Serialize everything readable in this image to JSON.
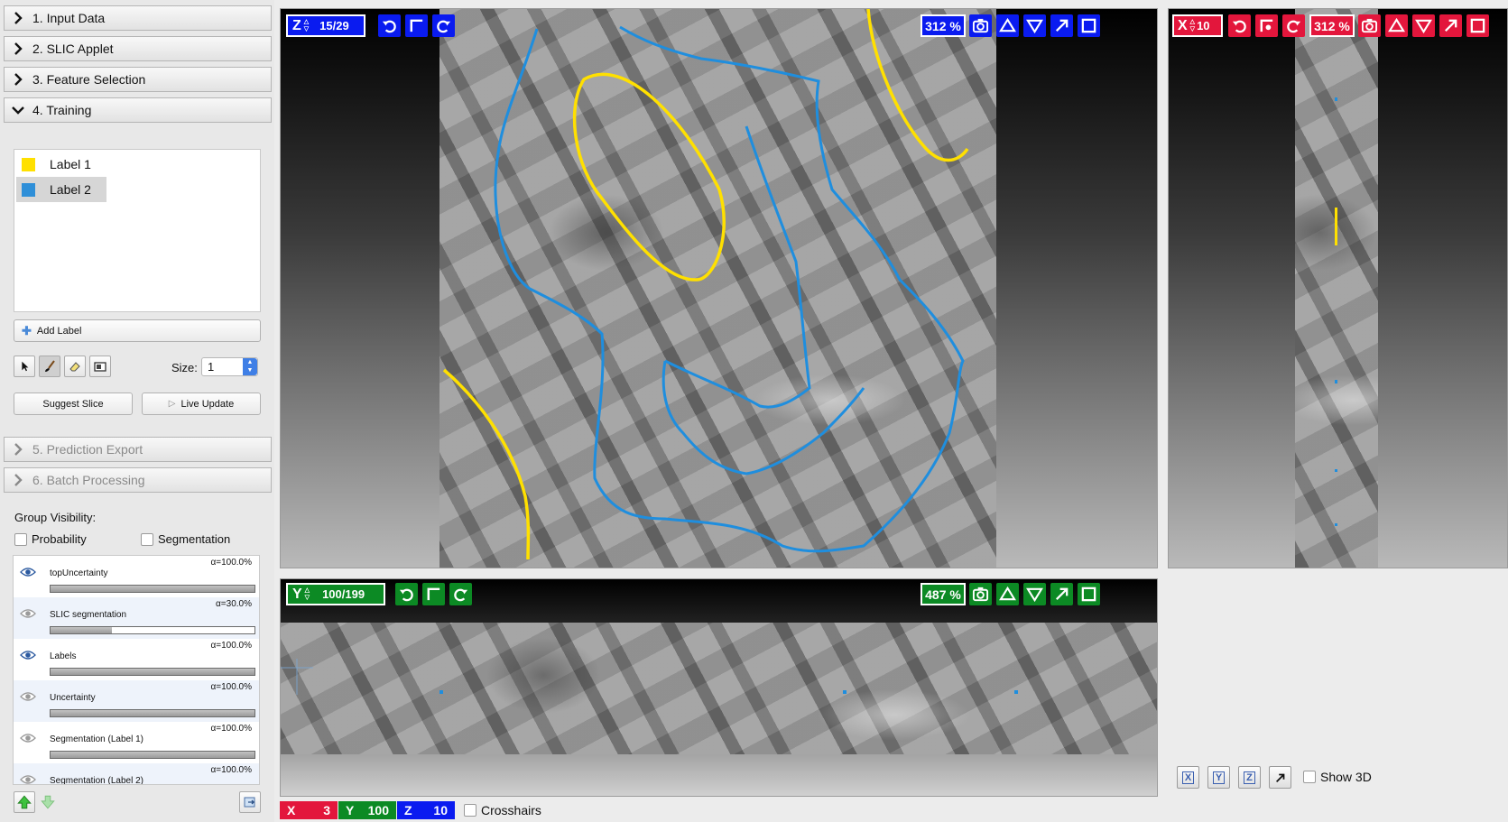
{
  "applets": [
    {
      "label": "1. Input Data",
      "expanded": false,
      "enabled": true
    },
    {
      "label": "2. SLIC Applet",
      "expanded": false,
      "enabled": true
    },
    {
      "label": "3. Feature Selection",
      "expanded": false,
      "enabled": true
    },
    {
      "label": "4. Training",
      "expanded": true,
      "enabled": true
    },
    {
      "label": "5. Prediction Export",
      "expanded": false,
      "enabled": false
    },
    {
      "label": "6. Batch Processing",
      "expanded": false,
      "enabled": false
    }
  ],
  "training": {
    "labels": [
      {
        "name": "Label 1",
        "color": "#ffe000",
        "selected": false
      },
      {
        "name": "Label 2",
        "color": "#2f8fd8",
        "selected": true
      }
    ],
    "add_label": "Add Label",
    "size_label": "Size:",
    "size_value": "1",
    "suggest_slice": "Suggest Slice",
    "live_update": "Live Update"
  },
  "group_visibility": {
    "title": "Group Visibility:",
    "probability": "Probability",
    "segmentation": "Segmentation"
  },
  "layers": [
    {
      "name": "topUncertainty",
      "alpha_text": "α=100.0%",
      "alpha": 1.0,
      "visible": true
    },
    {
      "name": "SLIC segmentation",
      "alpha_text": "α=30.0%",
      "alpha": 0.3,
      "visible": false
    },
    {
      "name": "Labels",
      "alpha_text": "α=100.0%",
      "alpha": 1.0,
      "visible": true
    },
    {
      "name": "Uncertainty",
      "alpha_text": "α=100.0%",
      "alpha": 1.0,
      "visible": false
    },
    {
      "name": "Segmentation (Label 1)",
      "alpha_text": "α=100.0%",
      "alpha": 1.0,
      "visible": false
    },
    {
      "name": "Segmentation (Label 2)",
      "alpha_text": "α=100.0%",
      "alpha": 1.0,
      "visible": false
    }
  ],
  "viewers": {
    "z": {
      "axis": "Z",
      "slice": "15/29",
      "zoom": "312 %",
      "color": "#0a1bf0"
    },
    "x": {
      "axis": "X",
      "slice": "10",
      "zoom": "312 %",
      "color": "#e3163c"
    },
    "y": {
      "axis": "Y",
      "slice": "100/199",
      "zoom": "487 %",
      "color": "#0c8a24"
    }
  },
  "coords": {
    "x_label": "X",
    "x_value": "3",
    "y_label": "Y",
    "y_value": "100",
    "z_label": "Z",
    "z_value": "10",
    "crosshairs": "Crosshairs"
  },
  "view_buttons": [
    "X",
    "Y",
    "Z"
  ],
  "show_3d": "Show 3D",
  "colors": {
    "label1": "#ffe000",
    "label2": "#2f8fd8",
    "z_axis": "#0a1bf0",
    "x_axis": "#e3163c",
    "y_axis": "#0c8a24"
  }
}
